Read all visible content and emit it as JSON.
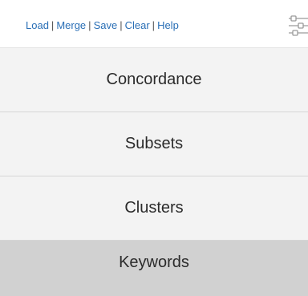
{
  "toolbar": {
    "links": [
      "Load",
      "Merge",
      "Save",
      "Clear",
      "Help"
    ],
    "separator": "|",
    "settings_icon": "sliders-icon"
  },
  "menu": {
    "items": [
      {
        "label": "Concordance"
      },
      {
        "label": "Subsets"
      },
      {
        "label": "Clusters"
      },
      {
        "label": "Keywords"
      }
    ],
    "active_index": 3
  },
  "colors": {
    "link": "#2a6fb6",
    "item_bg": "#f3f3f3",
    "active_bg": "#d1d1d1",
    "divider": "#d6d6d6"
  }
}
